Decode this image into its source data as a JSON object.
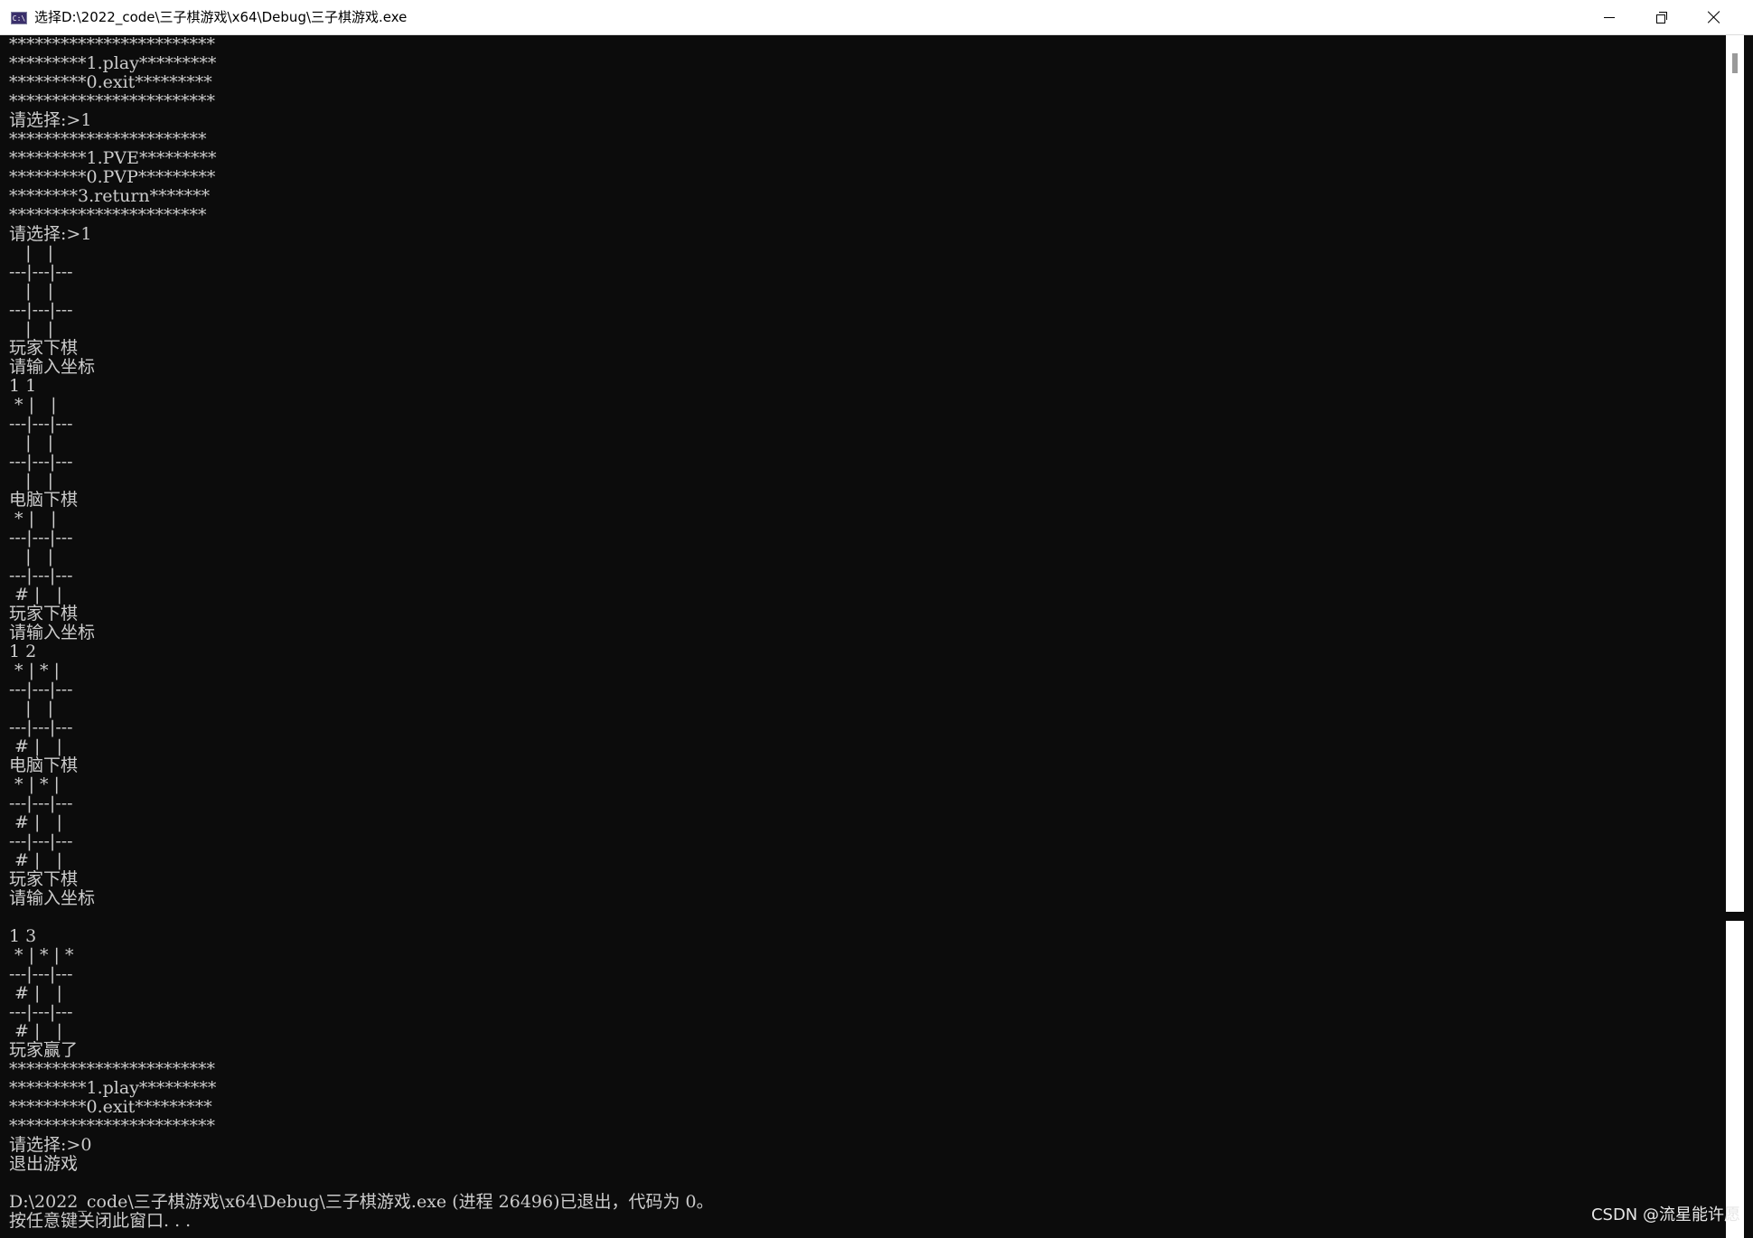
{
  "window": {
    "icon_label": "C:\\",
    "title": "选择D:\\2022_code\\三子棋游戏\\x64\\Debug\\三子棋游戏.exe"
  },
  "console": {
    "lines": [
      "************************",
      "*********1.play*********",
      "*********0.exit*********",
      "************************",
      "请选择:>1",
      "***********************",
      "*********1.PVE*********",
      "*********0.PVP*********",
      "********3.return*******",
      "***********************",
      "请选择:>1",
      "   |   |   ",
      "---|---|---",
      "   |   |   ",
      "---|---|---",
      "   |   |   ",
      "玩家下棋",
      "请输入坐标",
      "1 1",
      " * |   |   ",
      "---|---|---",
      "   |   |   ",
      "---|---|---",
      "   |   |   ",
      "电脑下棋",
      " * |   |   ",
      "---|---|---",
      "   |   |   ",
      "---|---|---",
      " # |   |   ",
      "玩家下棋",
      "请输入坐标",
      "1 2",
      " * | * |   ",
      "---|---|---",
      "   |   |   ",
      "---|---|---",
      " # |   |   ",
      "电脑下棋",
      " * | * |   ",
      "---|---|---",
      " # |   |   ",
      "---|---|---",
      " # |   |   ",
      "玩家下棋",
      "请输入坐标",
      "",
      "1 3",
      " * | * | * ",
      "---|---|---",
      " # |   |   ",
      "---|---|---",
      " # |   |   ",
      "玩家赢了",
      "************************",
      "*********1.play*********",
      "*********0.exit*********",
      "************************",
      "请选择:>0",
      "退出游戏",
      "",
      "D:\\2022_code\\三子棋游戏\\x64\\Debug\\三子棋游戏.exe (进程 26496)已退出，代码为 0。",
      "按任意键关闭此窗口. . ."
    ],
    "foreground": "#cccccc",
    "background": "#0c0c0c"
  },
  "watermark": {
    "text": "CSDN @流星能许愿"
  }
}
